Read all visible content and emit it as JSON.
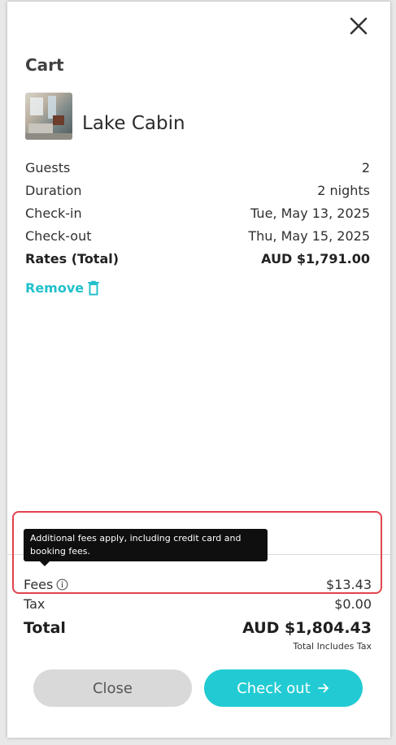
{
  "header": {
    "title": "Cart",
    "close_icon": "close-icon"
  },
  "item": {
    "name": "Lake Cabin",
    "thumbnail": "cabin-interior-photo",
    "details": [
      {
        "label": "Guests",
        "value": "2"
      },
      {
        "label": "Duration",
        "value": "2 nights"
      },
      {
        "label": "Check-in",
        "value": "Tue, May 13, 2025"
      },
      {
        "label": "Check-out",
        "value": "Thu, May 15, 2025"
      }
    ],
    "rates": {
      "label": "Rates (Total)",
      "value": "AUD $1,791.00"
    },
    "remove_label": "Remove",
    "remove_icon": "trash-icon"
  },
  "summary": {
    "tooltip": "Additional fees apply, including credit card and booking fees.",
    "fees": {
      "label": "Fees",
      "value": "$13.43",
      "icon": "info-icon"
    },
    "tax": {
      "label": "Tax",
      "value": "$0.00"
    },
    "total": {
      "label": "Total",
      "value": "AUD $1,804.43"
    },
    "total_note": "Total Includes Tax"
  },
  "actions": {
    "close_label": "Close",
    "checkout_label": "Check out",
    "checkout_icon": "arrow-right-icon"
  },
  "colors": {
    "accent": "#22cbd3",
    "remove": "#22c1cc",
    "highlight": "#e0444c",
    "tooltip_bg": "#0f0f0f"
  }
}
